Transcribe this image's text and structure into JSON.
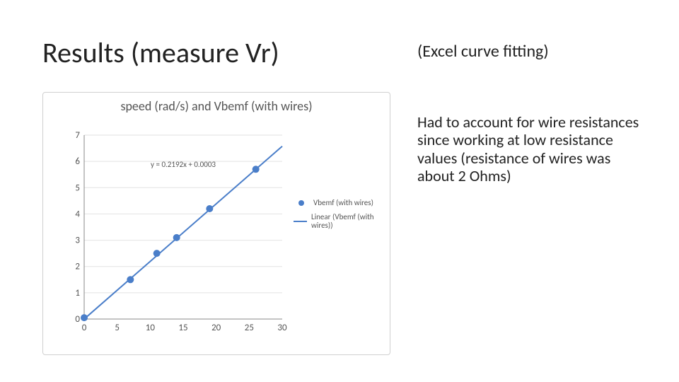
{
  "title": "Results (measure Vr)",
  "subtitle": "(Excel curve fitting)",
  "paragraph": "Had to account for wire resistances since working at low resistance values (resistance of wires was about 2 Ohms)",
  "chart_data": {
    "type": "scatter",
    "title": "speed (rad/s) and Vbemf (with wires)",
    "equation": "y = 0.2192x + 0.0003",
    "xlabel": "",
    "ylabel": "",
    "xlim": [
      0,
      30
    ],
    "ylim": [
      0,
      7
    ],
    "xticks": [
      0,
      5,
      10,
      15,
      20,
      25,
      30
    ],
    "yticks": [
      0,
      1,
      2,
      3,
      4,
      5,
      6,
      7
    ],
    "series": [
      {
        "name": "Vbemf (with wires)",
        "kind": "points",
        "x": [
          0,
          7,
          11,
          14,
          19,
          26
        ],
        "y": [
          0.05,
          1.5,
          2.5,
          3.1,
          4.2,
          5.7
        ]
      },
      {
        "name": "Linear (Vbemf (with wires))",
        "kind": "line",
        "slope": 0.2192,
        "intercept": 0.0003
      }
    ],
    "legend": [
      "Vbemf (with wires)",
      "Linear (Vbemf (with wires))"
    ]
  }
}
